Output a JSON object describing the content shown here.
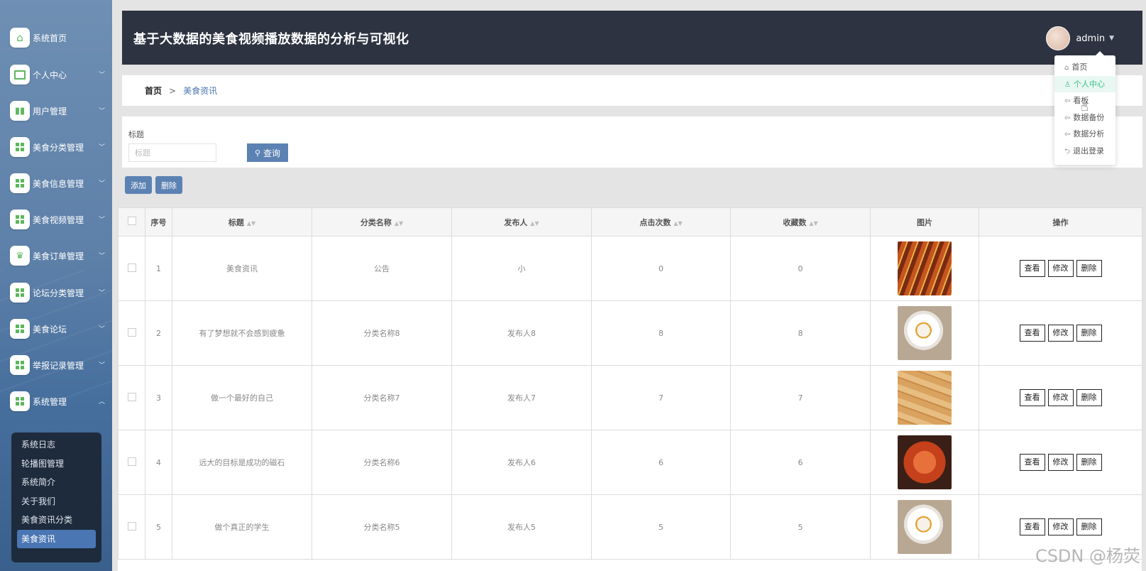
{
  "header": {
    "title": "基于大数据的美食视频播放数据的分析与可视化",
    "user": "admin"
  },
  "sidebar": {
    "items": [
      {
        "label": "系统首页",
        "icon": "home-icon",
        "has_caret": false
      },
      {
        "label": "个人中心",
        "icon": "card-icon",
        "has_caret": true
      },
      {
        "label": "用户管理",
        "icon": "bar-chart-icon",
        "has_caret": true
      },
      {
        "label": "美食分类管理",
        "icon": "grid-icon",
        "has_caret": true
      },
      {
        "label": "美食信息管理",
        "icon": "grid-icon",
        "has_caret": true
      },
      {
        "label": "美食视频管理",
        "icon": "grid-icon",
        "has_caret": true
      },
      {
        "label": "美食订单管理",
        "icon": "trophy-icon",
        "has_caret": true
      },
      {
        "label": "论坛分类管理",
        "icon": "grid-icon",
        "has_caret": true
      },
      {
        "label": "美食论坛",
        "icon": "grid-icon",
        "has_caret": true
      },
      {
        "label": "举报记录管理",
        "icon": "grid-icon",
        "has_caret": true
      },
      {
        "label": "系统管理",
        "icon": "grid-icon",
        "has_caret": true,
        "expanded": true
      }
    ],
    "submenu": [
      "系统日志",
      "轮播图管理",
      "系统简介",
      "关于我们",
      "美食资讯分类",
      "美食资讯"
    ],
    "submenu_active": "美食资讯"
  },
  "dropdown": [
    "首页",
    "个人中心",
    "看板",
    "数据备份",
    "数据分析",
    "退出登录"
  ],
  "breadcrumb": {
    "home": "首页",
    "separator": ">",
    "current": "美食资讯"
  },
  "search": {
    "label": "标题",
    "placeholder": "标题",
    "button": "查询"
  },
  "actions": {
    "add": "添加",
    "delete": "删除"
  },
  "table": {
    "columns": [
      "序号",
      "标题",
      "分类名称",
      "发布人",
      "点击次数",
      "收藏数",
      "图片",
      "操作"
    ],
    "rows": [
      {
        "no": "1",
        "title": "美食资讯",
        "category": "公告",
        "publisher": "小",
        "clicks": "0",
        "favorites": "0",
        "image": "skewers"
      },
      {
        "no": "2",
        "title": "有了梦想就不会感到疲惫",
        "category": "分类名称8",
        "publisher": "发布人8",
        "clicks": "8",
        "favorites": "8",
        "image": "dessert"
      },
      {
        "no": "3",
        "title": "做一个最好的自己",
        "category": "分类名称7",
        "publisher": "发布人7",
        "clicks": "7",
        "favorites": "7",
        "image": "crepes"
      },
      {
        "no": "4",
        "title": "远大的目标是成功的磁石",
        "category": "分类名称6",
        "publisher": "发布人6",
        "clicks": "6",
        "favorites": "6",
        "image": "shrimp"
      },
      {
        "no": "5",
        "title": "做个真正的学生",
        "category": "分类名称5",
        "publisher": "发布人5",
        "clicks": "5",
        "favorites": "5",
        "image": "dessert"
      }
    ],
    "row_actions": {
      "view": "查看",
      "edit": "修改",
      "delete": "删除"
    }
  },
  "watermark": "CSDN @杨荧",
  "colors": {
    "header_bg": "#2d3340",
    "accent": "#5b82b3",
    "active_sub": "#4a76b3"
  }
}
